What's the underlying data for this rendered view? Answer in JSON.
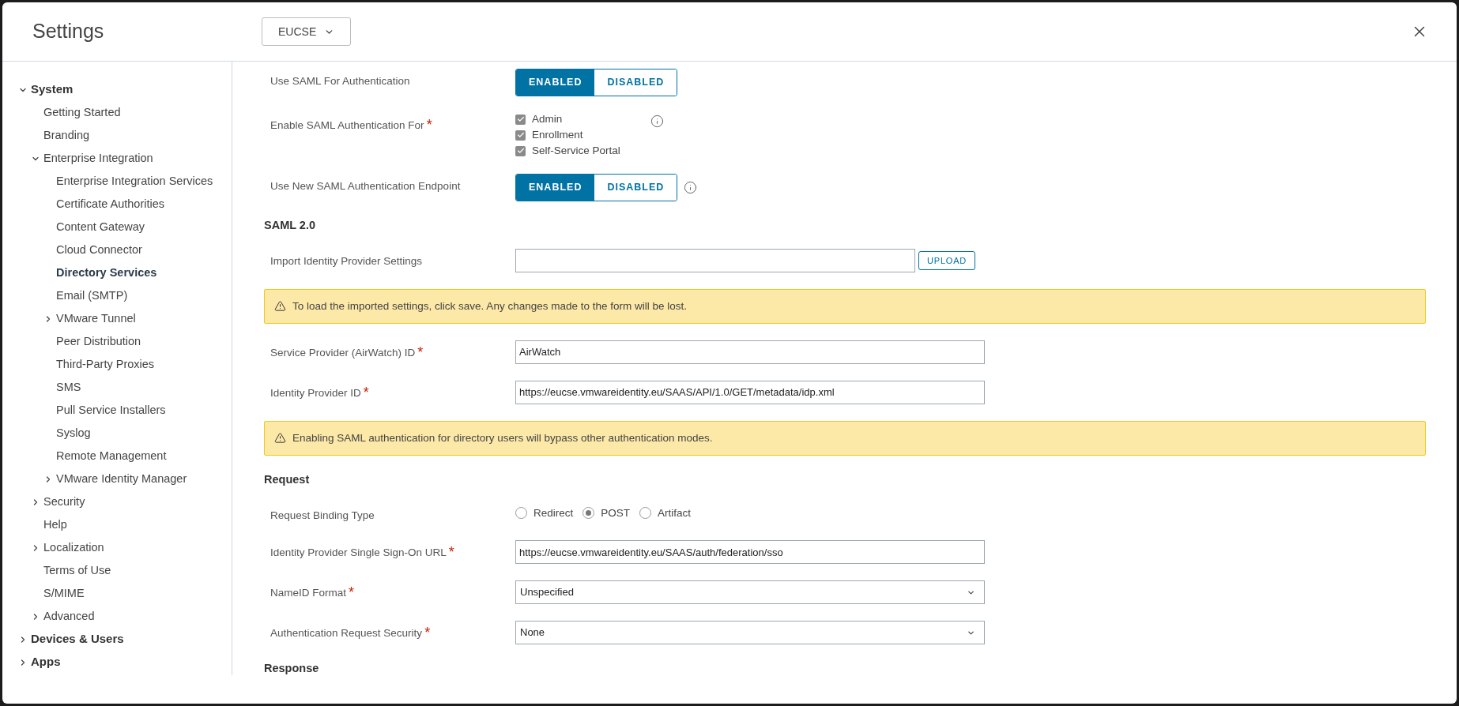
{
  "header": {
    "title": "Settings",
    "org_dropdown": "EUCSE"
  },
  "sidebar": {
    "items": [
      {
        "label": "System",
        "expanded": true,
        "selected": false,
        "children": [
          {
            "label": "Getting Started",
            "selected": false
          },
          {
            "label": "Branding",
            "selected": false
          },
          {
            "label": "Enterprise Integration",
            "expanded": true,
            "selected": false,
            "children": [
              {
                "label": "Enterprise Integration Services",
                "selected": false
              },
              {
                "label": "Certificate Authorities",
                "selected": false
              },
              {
                "label": "Content Gateway",
                "selected": false
              },
              {
                "label": "Cloud Connector",
                "selected": false
              },
              {
                "label": "Directory Services",
                "selected": true
              },
              {
                "label": "Email (SMTP)",
                "selected": false
              },
              {
                "label": "VMware Tunnel",
                "expanded": false,
                "selected": false
              },
              {
                "label": "Peer Distribution",
                "selected": false
              },
              {
                "label": "Third-Party Proxies",
                "selected": false
              },
              {
                "label": "SMS",
                "selected": false
              },
              {
                "label": "Pull Service Installers",
                "selected": false
              },
              {
                "label": "Syslog",
                "selected": false
              },
              {
                "label": "Remote Management",
                "selected": false
              },
              {
                "label": "VMware Identity Manager",
                "expanded": false,
                "selected": false
              }
            ]
          },
          {
            "label": "Security",
            "expanded": false,
            "selected": false
          },
          {
            "label": "Help",
            "selected": false
          },
          {
            "label": "Localization",
            "expanded": false,
            "selected": false
          },
          {
            "label": "Terms of Use",
            "selected": false
          },
          {
            "label": "S/MIME",
            "selected": false
          },
          {
            "label": "Advanced",
            "expanded": false,
            "selected": false
          }
        ]
      },
      {
        "label": "Devices & Users",
        "expanded": false,
        "selected": false
      },
      {
        "label": "Apps",
        "expanded": false,
        "selected": false
      }
    ]
  },
  "form": [
    {
      "kind": "toggle",
      "label": "Use SAML For Authentication",
      "options": [
        {
          "label": "ENABLED",
          "selected": true
        },
        {
          "label": "DISABLED",
          "selected": false
        }
      ]
    },
    {
      "kind": "checkboxes",
      "label": "Enable SAML Authentication For",
      "required_mark": "*",
      "info": true,
      "options": [
        {
          "label": "Admin",
          "checked": true
        },
        {
          "label": "Enrollment",
          "checked": true
        },
        {
          "label": "Self-Service Portal",
          "checked": true
        }
      ]
    },
    {
      "kind": "toggle",
      "label": "Use New SAML Authentication Endpoint",
      "info": true,
      "options": [
        {
          "label": "ENABLED",
          "selected": true
        },
        {
          "label": "DISABLED",
          "selected": false
        }
      ]
    },
    {
      "kind": "heading",
      "label": "SAML 2.0"
    },
    {
      "kind": "upload",
      "label": "Import Identity Provider Settings",
      "button": "UPLOAD"
    },
    {
      "kind": "alert",
      "text": "To load the imported settings, click save. Any changes made to the form will be lost."
    },
    {
      "kind": "text",
      "label": "Service Provider (AirWatch) ID",
      "required_mark": "*",
      "value": "AirWatch"
    },
    {
      "kind": "text",
      "label": "Identity Provider ID",
      "required_mark": "*",
      "value": "https://eucse.vmwareidentity.eu/SAAS/API/1.0/GET/metadata/idp.xml"
    },
    {
      "kind": "alert",
      "text": "Enabling SAML authentication for directory users will bypass other authentication modes."
    },
    {
      "kind": "heading",
      "label": "Request"
    },
    {
      "kind": "radio",
      "label": "Request Binding Type",
      "options": [
        {
          "label": "Redirect",
          "selected": false
        },
        {
          "label": "POST",
          "selected": true
        },
        {
          "label": "Artifact",
          "selected": false
        }
      ]
    },
    {
      "kind": "text",
      "label": "Identity Provider Single Sign-On URL",
      "required_mark": "*",
      "value": "https://eucse.vmwareidentity.eu/SAAS/auth/federation/sso"
    },
    {
      "kind": "select",
      "label": "NameID Format",
      "required_mark": "*",
      "value": "Unspecified"
    },
    {
      "kind": "select",
      "label": "Authentication Request Security",
      "required_mark": "*",
      "value": "None"
    },
    {
      "kind": "heading",
      "label": "Response"
    }
  ]
}
